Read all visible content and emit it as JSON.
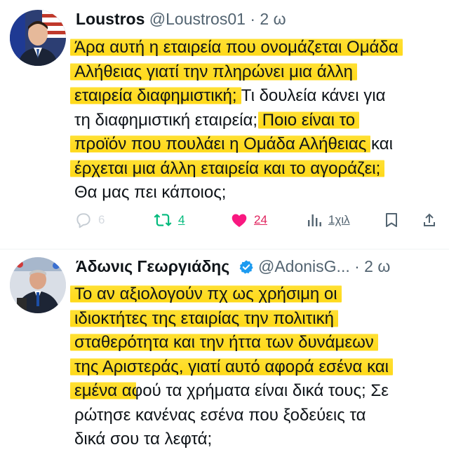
{
  "tweets": [
    {
      "author": "Loustros",
      "handle": "@Loustros01",
      "dot": "·",
      "time": "2 ω",
      "lines": [
        [
          "Άρα αυτή η εταιρεία που ονομάζεται Ομάδα",
          ""
        ],
        [
          "Αλήθειας γιατί την πληρώνει μια άλλη",
          ""
        ],
        [
          "εταιρεία διαφημιστική;",
          " Τι δουλεία κάνει για"
        ],
        [
          "τη διαφημιστική εταιρεία;",
          "Ποιο είναι το"
        ],
        [
          "προϊόν που πουλάει η Ομάδα Αλήθειας",
          " και"
        ],
        [
          "έρχεται μια άλλη εταιρεία και το αγοράζει;",
          ""
        ],
        [
          "Θα μας πει κάποιος;",
          ""
        ]
      ],
      "actions": {
        "reply_count": "6",
        "retweet_count": "4",
        "like_count": "24",
        "views_count": "1χιλ"
      }
    },
    {
      "author": "Άδωνις Γεωργιάδης",
      "handle": "@AdonisG...",
      "dot": "·",
      "time": "2 ω",
      "verified": true,
      "lines": [
        [
          "Το αν αξιολογούν πχ ως χρήσιμη οι",
          ""
        ],
        [
          "ιδιοκτήτες της εταιρίας την πολιτική",
          ""
        ],
        [
          "σταθερότητα και την ήττα των δυνάμεων",
          ""
        ],
        [
          "της Αριστεράς, γιατί αυτό αφορά εσένα και",
          ""
        ],
        [
          "εμένα α",
          "φού τα χρήματα είναι δικά τους; Σε"
        ],
        [
          "ρώτησε κανένας εσένα που ξοδεύεις τα",
          ""
        ],
        [
          "δικά σου τα λεφτά;",
          ""
        ]
      ]
    }
  ],
  "colors": {
    "highlight": "#ffd91a",
    "retweet": "#00ba7c",
    "like": "#f91880",
    "verified": "#1d9bf0",
    "muted": "#536471"
  }
}
